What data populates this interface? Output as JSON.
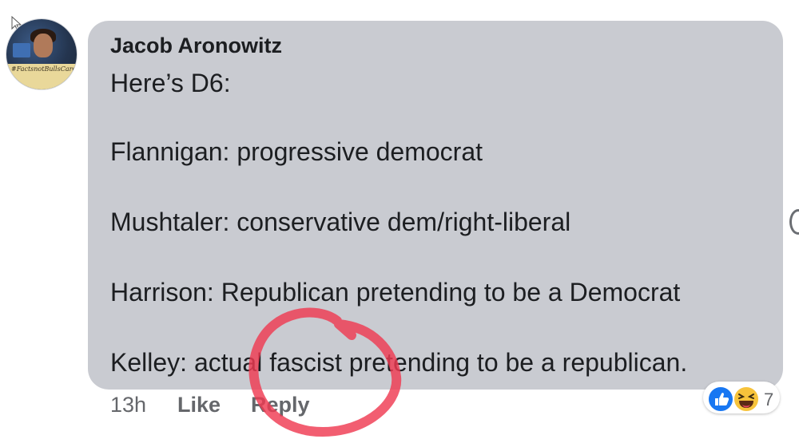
{
  "comment": {
    "author": "Jacob Aronowitz",
    "lines": [
      "Here’s D6:",
      "Flannigan: progressive democrat",
      "Mushtaler: conservative dem/right-liberal",
      "Harrison: Republican pretending to be a Democrat",
      "Kelley: actual fascist pretending to be a republican."
    ]
  },
  "avatar": {
    "band_text": "#FactsnotBullsCare"
  },
  "footer": {
    "time": "13h",
    "like_label": "Like",
    "reply_label": "Reply"
  },
  "reactions": {
    "icons": [
      "like-icon",
      "haha-icon"
    ],
    "count": "7"
  },
  "colors": {
    "bubble": "#c9cbd1",
    "text": "#1c1e21",
    "meta": "#65676b",
    "like_blue": "#1877f2",
    "haha_yellow": "#f7c33b",
    "annotation_red": "#ef3b52"
  }
}
